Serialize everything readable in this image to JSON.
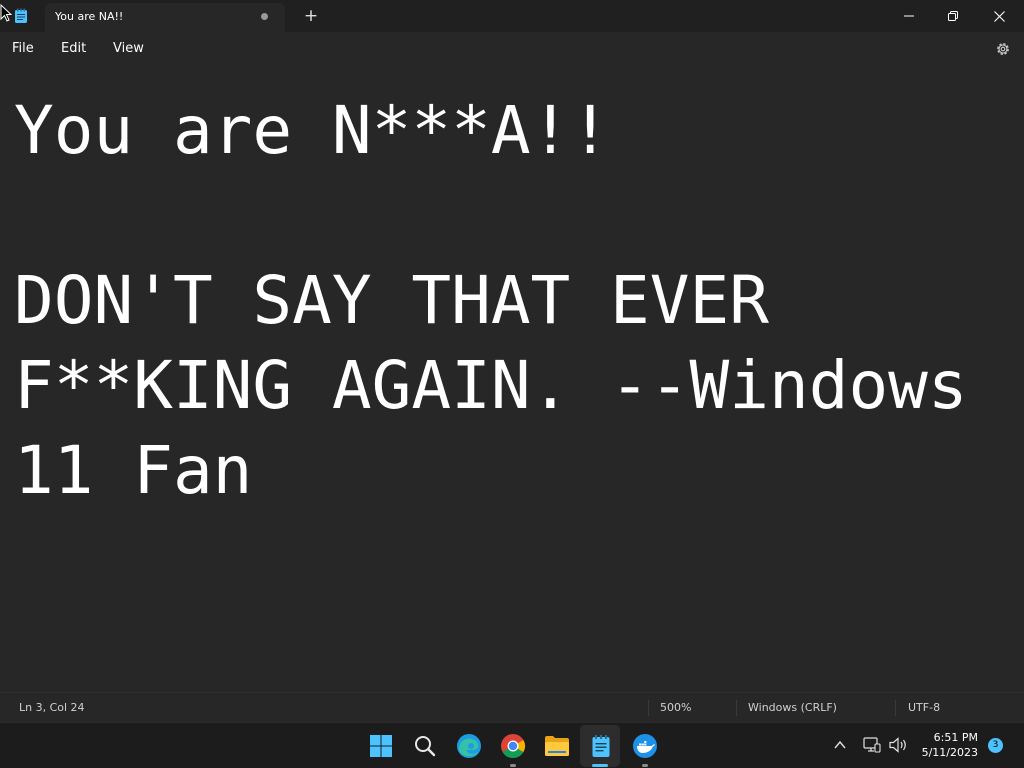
{
  "window": {
    "tab_title": "You are NA!!",
    "new_tab_label": "+"
  },
  "menu": {
    "file": "File",
    "edit": "Edit",
    "view": "View"
  },
  "editor": {
    "content": "You are N***A!!\n\nDON'T SAY THAT EVER F**KING AGAIN. --Windows 11 Fan"
  },
  "status": {
    "position": "Ln 3, Col 24",
    "zoom": "500%",
    "line_ending": "Windows (CRLF)",
    "encoding": "UTF-8"
  },
  "taskbar": {
    "apps": [
      "start-icon",
      "search-icon",
      "edge-icon",
      "chrome-icon",
      "file-explorer-icon",
      "notepad-icon",
      "docker-icon"
    ],
    "time": "6:51 PM",
    "date": "5/11/2023",
    "notification_count": "3"
  },
  "colors": {
    "background": "#272727",
    "titlebar": "#202020",
    "taskbar": "#1c1c1c",
    "accent": "#4cc2ff"
  }
}
